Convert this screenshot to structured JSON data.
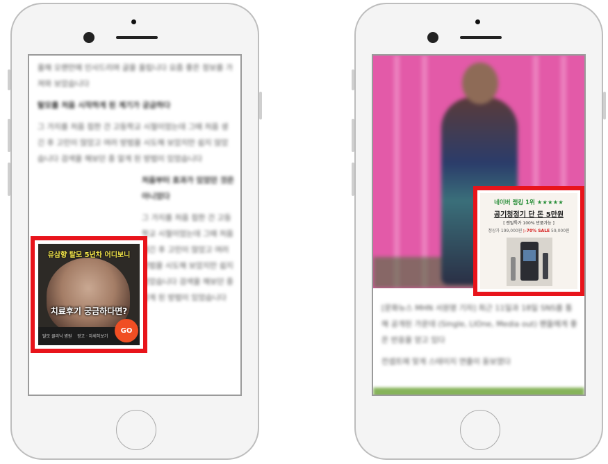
{
  "left_phone": {
    "article_paragraphs": [
      "올해 오랜만에 인사드리며 글을 올립니다 요즘 좋은 정보를 가져와 보았습니다",
      "탈모를 처음 시작하게 된 계기가 궁금하다",
      "그 가지를 처음 접한 건 고등학교 시절이었는데 그때 처음 생긴 후 고민이 많았고 여러 방법을 시도해 보았지만 쉽지 않았습니다 검색을 해보던 중 알게 된 방법이 있었습니다",
      "처음부터 효과가 있었던 것은 아니었다"
    ],
    "ad": {
      "top_text": "유삼향 탈모 5년차 어디보니",
      "mid_text": "치료후기 궁금하다면?",
      "small_left": "탈모 클리닉 병원",
      "small_mid": "광고 · 자세히보기",
      "go_label": "GO"
    }
  },
  "right_phone": {
    "ad": {
      "line1": "네이버 랭킹 1위 ★★★★★",
      "line2": "공기청정기 단 돈 5만원",
      "line3": "[ 렌탈특가 100% 반품가능 ]",
      "line4_prefix": "정상가 199,000원",
      "line4_sale": "▷70% SALE",
      "line4_suffix": "59,000원"
    },
    "article_paragraphs": [
      "[문화뉴스 MHN 서원영 기자] 최근 11일과 18일 SNS를 통해 공개된 가운데 (Single, LIOne, Media out) 팬들에게 좋은 반응을 얻고 있다",
      "컨셉트에 맞게 스테이지 연출이 돋보였다"
    ]
  }
}
